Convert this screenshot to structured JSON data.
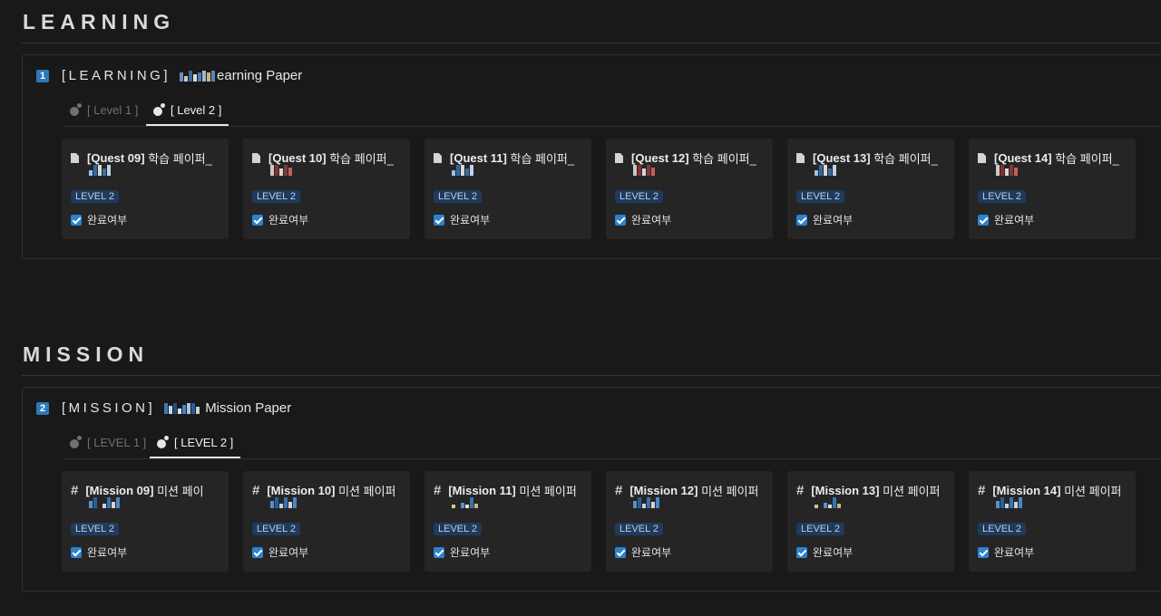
{
  "learning": {
    "heading": "LEARNING",
    "panel_number": "1",
    "panel_tag": "[LEARNING]",
    "panel_title": "earning Paper",
    "tabs": [
      {
        "label": "[ Level 1 ]",
        "active": false
      },
      {
        "label": "[ Level 2 ]",
        "active": true
      }
    ],
    "cards": [
      {
        "code": "[Quest 09]",
        "title": "학습 페이퍼_",
        "level": "LEVEL 2",
        "done_label": "완료여부",
        "done": true
      },
      {
        "code": "[Quest 10]",
        "title": "학습 페이퍼_",
        "level": "LEVEL 2",
        "done_label": "완료여부",
        "done": true
      },
      {
        "code": "[Quest 11]",
        "title": "학습 페이퍼_",
        "level": "LEVEL 2",
        "done_label": "완료여부",
        "done": true
      },
      {
        "code": "[Quest 12]",
        "title": "학습 페이퍼_",
        "level": "LEVEL 2",
        "done_label": "완료여부",
        "done": true
      },
      {
        "code": "[Quest 13]",
        "title": "학습 페이퍼_",
        "level": "LEVEL 2",
        "done_label": "완료여부",
        "done": true
      },
      {
        "code": "[Quest 14]",
        "title": "학습 페이퍼_",
        "level": "LEVEL 2",
        "done_label": "완료여부",
        "done": true
      }
    ]
  },
  "mission": {
    "heading": "MISSION",
    "panel_number": "2",
    "panel_tag": "[MISSION]",
    "panel_title": "Mission Paper",
    "tabs": [
      {
        "label": "[ LEVEL 1 ]",
        "active": false
      },
      {
        "label": "[ LEVEL 2 ]",
        "active": true
      }
    ],
    "cards": [
      {
        "code": "[Mission 09]",
        "title": "미션 페이",
        "level": "LEVEL 2",
        "done_label": "완료여부",
        "done": true
      },
      {
        "code": "[Mission 10]",
        "title": "미션 페이퍼",
        "level": "LEVEL 2",
        "done_label": "완료여부",
        "done": true
      },
      {
        "code": "[Mission 11]",
        "title": "미션 페이퍼",
        "level": "LEVEL 2",
        "done_label": "완료여부",
        "done": true
      },
      {
        "code": "[Mission 12]",
        "title": "미션 페이퍼",
        "level": "LEVEL 2",
        "done_label": "완료여부",
        "done": true
      },
      {
        "code": "[Mission 13]",
        "title": "미션 페이퍼",
        "level": "LEVEL 2",
        "done_label": "완료여부",
        "done": true
      },
      {
        "code": "[Mission 14]",
        "title": "미션 페이퍼",
        "level": "LEVEL 2",
        "done_label": "완료여부",
        "done": true
      }
    ]
  },
  "colors": {
    "background": "#191919",
    "card": "#252525",
    "badge": "#1f3a5c",
    "checkbox": "#2b82d0",
    "number_badge": "#2e79b8"
  }
}
